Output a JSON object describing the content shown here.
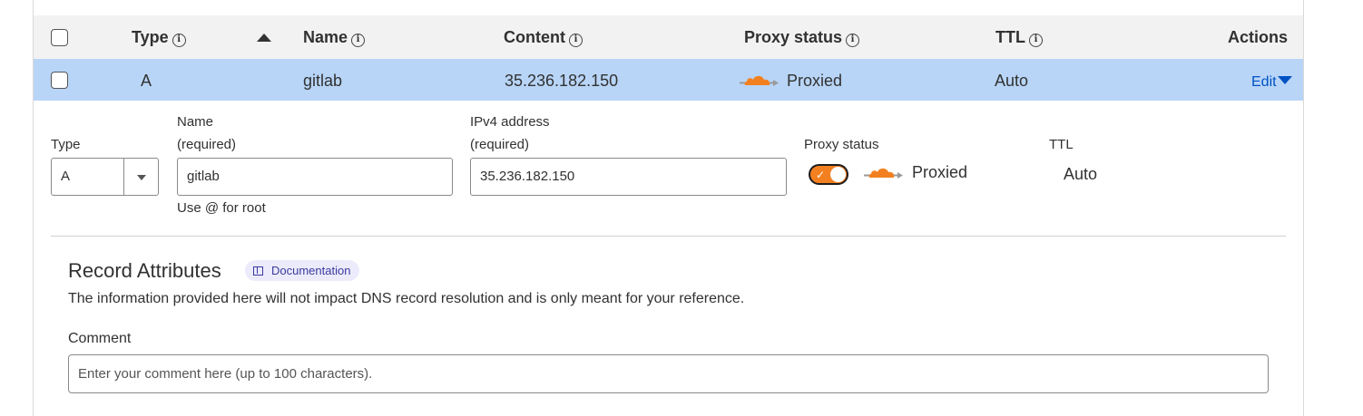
{
  "table": {
    "headers": {
      "type": "Type",
      "name": "Name",
      "content": "Content",
      "proxy_status": "Proxy status",
      "ttl": "TTL",
      "actions": "Actions"
    },
    "info_glyph": "i",
    "row": {
      "type": "A",
      "name": "gitlab",
      "content": "35.236.182.150",
      "proxy_status": "Proxied",
      "ttl": "Auto",
      "action_label": "Edit"
    }
  },
  "edit_form": {
    "type_label": "Type",
    "type_value": "A",
    "name_label": "Name",
    "name_required": "(required)",
    "name_value": "gitlab",
    "name_hint": "Use @ for root",
    "ipv4_label": "IPv4 address",
    "ipv4_required": "(required)",
    "ipv4_value": "35.236.182.150",
    "proxy_label": "Proxy status",
    "proxy_toggle_on": true,
    "proxy_value": "Proxied",
    "ttl_label": "TTL",
    "ttl_value": "Auto"
  },
  "record_attributes": {
    "title": "Record Attributes",
    "doc_badge": "Documentation",
    "description": "The information provided here will not impact DNS record resolution and is only meant for your reference.",
    "comment_label": "Comment",
    "comment_placeholder": "Enter your comment here (up to 100 characters)."
  },
  "colors": {
    "header_bg": "#f2f2f2",
    "selected_row_bg": "#b8d5f7",
    "link": "#0051c3",
    "cloud_orange": "#f38020",
    "badge_bg": "#ecebfb"
  },
  "icons": [
    "info-icon",
    "sort-ascending-icon",
    "proxied-cloud-icon",
    "caret-down-icon",
    "book-icon",
    "check-icon"
  ]
}
